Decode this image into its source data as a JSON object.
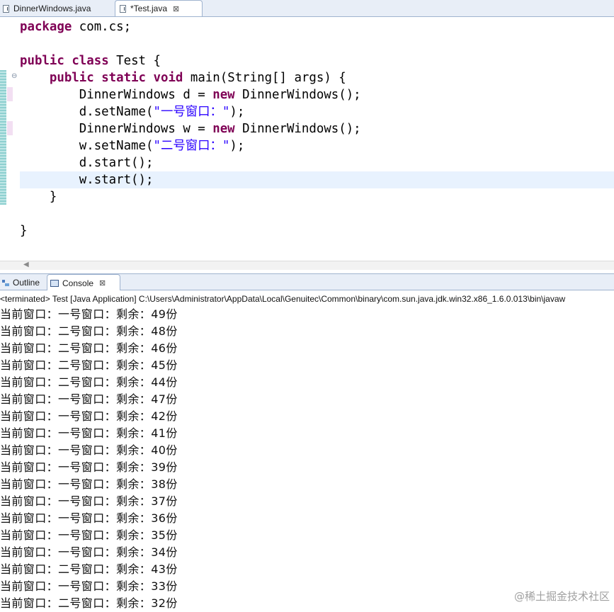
{
  "editor_tabs": [
    {
      "label": "DinnerWindows.java",
      "active": false
    },
    {
      "label": "*Test.java",
      "active": true,
      "close": "⊠"
    }
  ],
  "code": {
    "line1": {
      "kw": "package",
      "rest": " com.cs;"
    },
    "line2": {
      "text": ""
    },
    "line3": {
      "kw1": "public",
      "kw2": "class",
      "rest": " Test {"
    },
    "line4": {
      "indent": "    ",
      "kw1": "public",
      "kw2": "static",
      "kw3": "void",
      "rest": " main(String[] args) {"
    },
    "line5": {
      "pre": "        DinnerWindows d = ",
      "kw": "new",
      "post": " DinnerWindows();"
    },
    "line6": {
      "pre": "        d.setName(",
      "str": "\"一号窗口：\"",
      "post": ");"
    },
    "line7": {
      "pre": "        DinnerWindows w = ",
      "kw": "new",
      "post": " DinnerWindows();"
    },
    "line8": {
      "pre": "        w.setName(",
      "str": "\"二号窗口：\"",
      "post": ");"
    },
    "line9": {
      "text": "        d.start();"
    },
    "line10": {
      "text": "        w.start();"
    },
    "line11": {
      "text": "    }"
    },
    "line12": {
      "text": ""
    },
    "line13": {
      "text": "}"
    }
  },
  "view_tabs": {
    "outline": "Outline",
    "console": "Console",
    "console_close": "⊠"
  },
  "console": {
    "status": "<terminated> Test [Java Application] C:\\Users\\Administrator\\AppData\\Local\\Genuitec\\Common\\binary\\com.sun.java.jdk.win32.x86_1.6.0.013\\bin\\javaw",
    "lines": [
      "当前窗口：一号窗口：剩余：49份",
      "当前窗口：二号窗口：剩余：48份",
      "当前窗口：二号窗口：剩余：46份",
      "当前窗口：二号窗口：剩余：45份",
      "当前窗口：二号窗口：剩余：44份",
      "当前窗口：一号窗口：剩余：47份",
      "当前窗口：一号窗口：剩余：42份",
      "当前窗口：一号窗口：剩余：41份",
      "当前窗口：一号窗口：剩余：40份",
      "当前窗口：一号窗口：剩余：39份",
      "当前窗口：一号窗口：剩余：38份",
      "当前窗口：一号窗口：剩余：37份",
      "当前窗口：一号窗口：剩余：36份",
      "当前窗口：一号窗口：剩余：35份",
      "当前窗口：一号窗口：剩余：34份",
      "当前窗口：二号窗口：剩余：43份",
      "当前窗口：一号窗口：剩余：33份",
      "当前窗口：二号窗口：剩余：32份"
    ]
  },
  "watermark": "@稀土掘金技术社区",
  "colors": {
    "keyword": "#7f0055",
    "string": "#2a00ff",
    "current_line": "#e8f2fe"
  }
}
